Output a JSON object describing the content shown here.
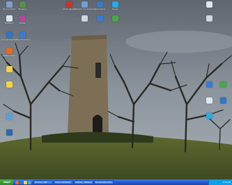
{
  "desktop": {
    "icons": [
      {
        "id": "my-computer",
        "label": "My Computer",
        "color": "#7f9fc7"
      },
      {
        "id": "notepad",
        "label": "Notepad",
        "color": "#d9e6f2"
      },
      {
        "id": "internet-explorer",
        "label": "Internet Explorer",
        "color": "#2f76c8"
      },
      {
        "id": "mozilla-firefox",
        "label": "Mozilla Firefox",
        "color": "#e66a1f"
      },
      {
        "id": "folder",
        "label": "",
        "color": "#f2d34e"
      },
      {
        "id": "folder-2",
        "label": "",
        "color": "#f2d34e"
      },
      {
        "id": "app-a",
        "label": "",
        "color": "#5aa0d8"
      },
      {
        "id": "app-b",
        "label": "",
        "color": "#3466a8"
      },
      {
        "id": "winamp",
        "label": "Winamp",
        "color": "#5a8f4a"
      },
      {
        "id": "picasa",
        "label": "Picasa",
        "color": "#b04a9b"
      },
      {
        "id": "adobe-photoshop",
        "label": "Adobe Photoshop",
        "color": "#3b7ccf"
      },
      {
        "id": "adobe-reader",
        "label": "Adobe Reader",
        "color": "#c0392b"
      },
      {
        "id": "network-connections",
        "label": "Network Connections",
        "color": "#6f9fd8"
      },
      {
        "id": "media-player",
        "label": "Media Player",
        "color": "#3a78c4"
      },
      {
        "id": "skype",
        "label": "Skype",
        "color": "#2aa7e0"
      },
      {
        "id": "icon-r2",
        "label": "",
        "color": "#cfd7e3"
      },
      {
        "id": "icon-r3",
        "label": "",
        "color": "#3b7cd0"
      },
      {
        "id": "icon-r4",
        "label": "",
        "color": "#48a848"
      },
      {
        "id": "icon-r5",
        "label": "",
        "color": "#e0e6ee"
      }
    ]
  },
  "taskbar": {
    "start_label": "start",
    "tasks": [
      {
        "label": "Panoram 360°"
      },
      {
        "label": "Yahoo! GeoCities"
      },
      {
        "label": "Untitled - Notepad"
      },
      {
        "label": "Documents and S..."
      }
    ],
    "clock": "2:26 AM"
  },
  "colors": {
    "taskbar": "#2256c9",
    "start": "#3a9a3a",
    "tray": "#0f9ee8"
  }
}
